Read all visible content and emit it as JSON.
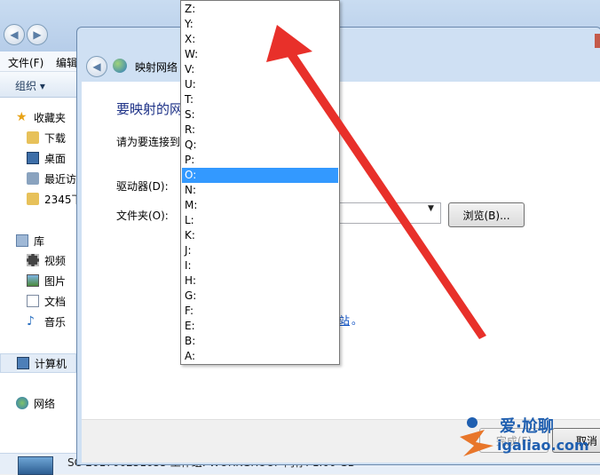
{
  "explorer": {
    "menu": [
      "文件(F)",
      "编辑"
    ],
    "toolbar_organize": "组织 ▾",
    "nav": {
      "favorites": "收藏夹",
      "downloads": "下载",
      "desktop": "桌面",
      "recent": "最近访",
      "folder2345": "2345下",
      "libraries": "库",
      "videos": "视频",
      "pictures": "图片",
      "documents": "文档",
      "music": "音乐",
      "computer": "计算机",
      "network": "网络"
    },
    "status_text": "SC-201706251055  工作组: WORKGROUP        内存: 1.00 GB"
  },
  "dialog": {
    "title": "映射网络",
    "heading": "要映射的网",
    "instruction": "请为要连接到",
    "drive_label": "驱动器(D):",
    "folder_label": "文件夹(O):",
    "browse_label": "浏览(B)...",
    "link_tail": "站",
    "link_dot": "。",
    "finish_label": "完成(F)",
    "cancel_label": "取消"
  },
  "drive_options": [
    "Z:",
    "Y:",
    "X:",
    "W:",
    "V:",
    "U:",
    "T:",
    "S:",
    "R:",
    "Q:",
    "P:",
    "O:",
    "N:",
    "M:",
    "L:",
    "K:",
    "J:",
    "I:",
    "H:",
    "G:",
    "F:",
    "E:",
    "B:",
    "A:"
  ],
  "selected_drive": "O:",
  "watermark": {
    "line1": "爱·尬聊",
    "line2": "igaliao.com"
  },
  "colors": {
    "selection": "#3399ff",
    "arrow": "#e8302a",
    "heading": "#1e3287"
  }
}
